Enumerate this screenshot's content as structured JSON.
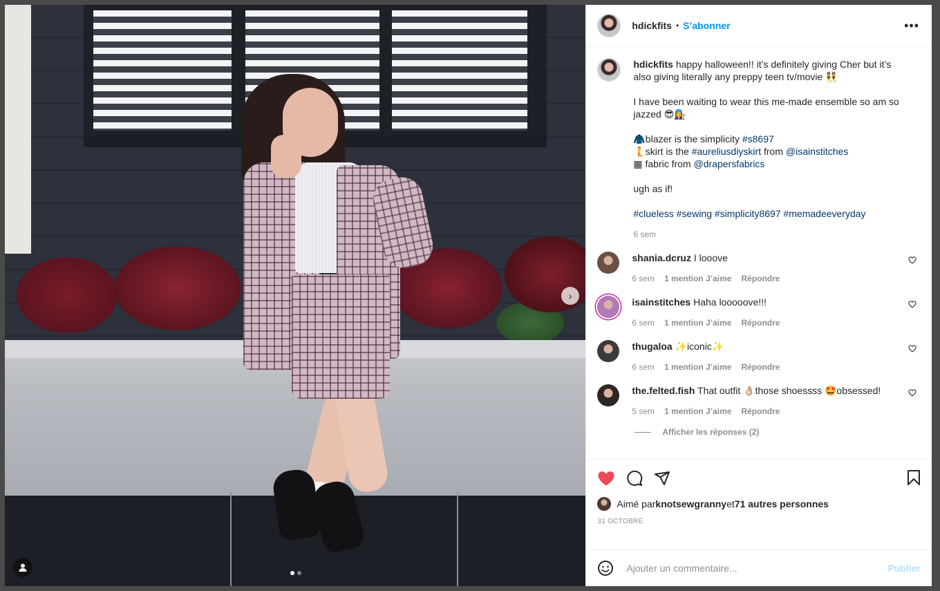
{
  "header": {
    "username": "hdickfits",
    "separator": "•",
    "follow_label": "S’abonner",
    "more_label": "•••"
  },
  "caption": {
    "username": "hdickfits",
    "line1": " happy halloween!! it’s definitely giving Cher but it’s also giving literally any preppy teen tv/movie 👯",
    "line2": "I have been waiting to wear this me-made ensemble so am so jazzed 😎👩‍🔧",
    "blazer_prefix": "🧥blazer is the simplicity ",
    "blazer_tag": "#s8697",
    "skirt_prefix": "🧜skirt is the ",
    "skirt_tag": "#aureliusdiyskirt",
    "skirt_mid": " from ",
    "skirt_mention": "@isainstitches",
    "fabric_prefix": "▦ fabric from ",
    "fabric_mention": "@drapersfabrics",
    "line4": "ugh as if!",
    "hashtags": "#clueless #sewing #simplicity8697 #memadeeveryday",
    "time": "6 sem"
  },
  "comments": [
    {
      "username": "shania.dcruz",
      "text": " I looove",
      "time": "6 sem",
      "likes": "1 mention J’aime",
      "reply": "Répondre",
      "avatar_color": "#6b4f42"
    },
    {
      "username": "isainstitches",
      "text": " Haha looooove!!!",
      "time": "6 sem",
      "likes": "1 mention J’aime",
      "reply": "Répondre",
      "avatar_color": "#b07ab8"
    },
    {
      "username": "thugaloa",
      "text": " ✨iconic✨",
      "time": "6 sem",
      "likes": "1 mention J’aime",
      "reply": "Répondre",
      "avatar_color": "#3c3a3c"
    },
    {
      "username": "the.felted.fish",
      "text": " That outfit 👌🏼those shoessss 🤩obsessed!",
      "time": "5 sem",
      "likes": "1 mention J’aime",
      "reply": "Répondre",
      "avatar_color": "#2d2622"
    }
  ],
  "show_replies": "Afficher les réponses (2)",
  "likes": {
    "prefix": "Aimé par ",
    "user": "knotsewgranny",
    "mid": " et ",
    "others": "71 autres personnes"
  },
  "date": "31 OCTOBRE",
  "composer": {
    "placeholder": "Ajouter un commentaire...",
    "publish": "Publier"
  },
  "carousel": {
    "slides": 2,
    "active": 1
  },
  "colors": {
    "accent": "#0095f6",
    "liked_heart": "#ed4956",
    "link": "#00376b",
    "publish_disabled": "#b2dffc"
  },
  "icons": [
    "heart-filled-icon",
    "comment-icon",
    "share-icon",
    "bookmark-icon",
    "emoji-icon",
    "more-icon",
    "next-arrow-icon",
    "user-tag-icon"
  ]
}
